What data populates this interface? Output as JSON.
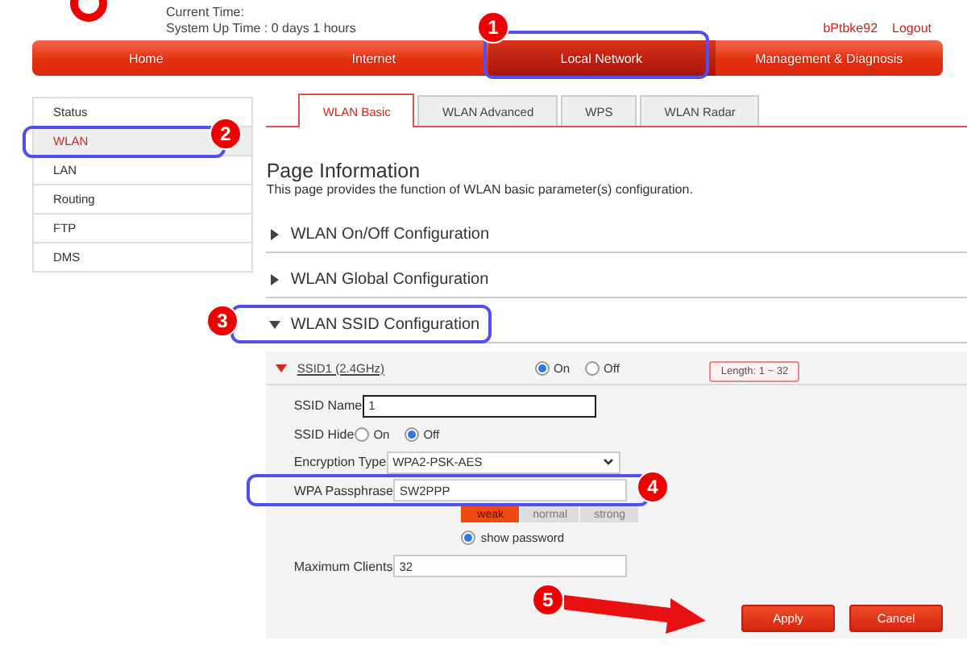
{
  "header": {
    "current_time_label": "Current Time:",
    "uptime": "System Up Time : 0 days 1 hours",
    "user": "bPtbke92",
    "logout": "Logout"
  },
  "nav": [
    {
      "label": "Home",
      "selected": false
    },
    {
      "label": "Internet",
      "selected": false
    },
    {
      "label": "Local Network",
      "selected": true
    },
    {
      "label": "Management & Diagnosis",
      "selected": false
    }
  ],
  "sidebar": {
    "items": [
      {
        "label": "Status",
        "selected": false
      },
      {
        "label": "WLAN",
        "selected": true
      },
      {
        "label": "LAN",
        "selected": false
      },
      {
        "label": "Routing",
        "selected": false
      },
      {
        "label": "FTP",
        "selected": false
      },
      {
        "label": "DMS",
        "selected": false
      }
    ]
  },
  "tabs": [
    {
      "label": "WLAN Basic",
      "selected": true
    },
    {
      "label": "WLAN Advanced",
      "selected": false
    },
    {
      "label": "WPS",
      "selected": false
    },
    {
      "label": "WLAN Radar",
      "selected": false
    }
  ],
  "page_info": {
    "title": "Page Information",
    "description": "This page provides the function of WLAN basic parameter(s) configuration."
  },
  "sections": [
    {
      "label": "WLAN On/Off Configuration",
      "expanded": false
    },
    {
      "label": "WLAN Global Configuration",
      "expanded": false
    },
    {
      "label": "WLAN SSID Configuration",
      "expanded": true
    }
  ],
  "ssid": {
    "name": "SSID1 (2.4GHz)",
    "expanded": true,
    "enable": [
      {
        "label": "On",
        "selected": true
      },
      {
        "label": "Off",
        "selected": false
      }
    ],
    "tooltip": "Length: 1 ~ 32",
    "fields": [
      {
        "kind": "text",
        "label": "SSID Name",
        "value": "1",
        "focused": true
      },
      {
        "kind": "radio",
        "label": "SSID Hide",
        "options": [
          {
            "label": "On",
            "selected": false
          },
          {
            "label": "Off",
            "selected": true
          }
        ]
      },
      {
        "kind": "select",
        "label": "Encryption Type",
        "value": "WPA2-PSK-AES"
      },
      {
        "kind": "text",
        "label": "WPA Passphrase",
        "value": "SW2PPP",
        "focused": false
      },
      {
        "kind": "strength",
        "options": [
          {
            "label": "weak",
            "selected": true
          },
          {
            "label": "normal",
            "selected": false
          },
          {
            "label": "strong",
            "selected": false
          }
        ]
      },
      {
        "kind": "toggle",
        "label": "show password",
        "checked": true
      },
      {
        "kind": "text",
        "label": "Maximum Clients",
        "value": "32",
        "focused": false
      }
    ],
    "buttons": [
      "Apply",
      "Cancel"
    ]
  },
  "annotations": [
    "1",
    "2",
    "3",
    "4",
    "5"
  ]
}
